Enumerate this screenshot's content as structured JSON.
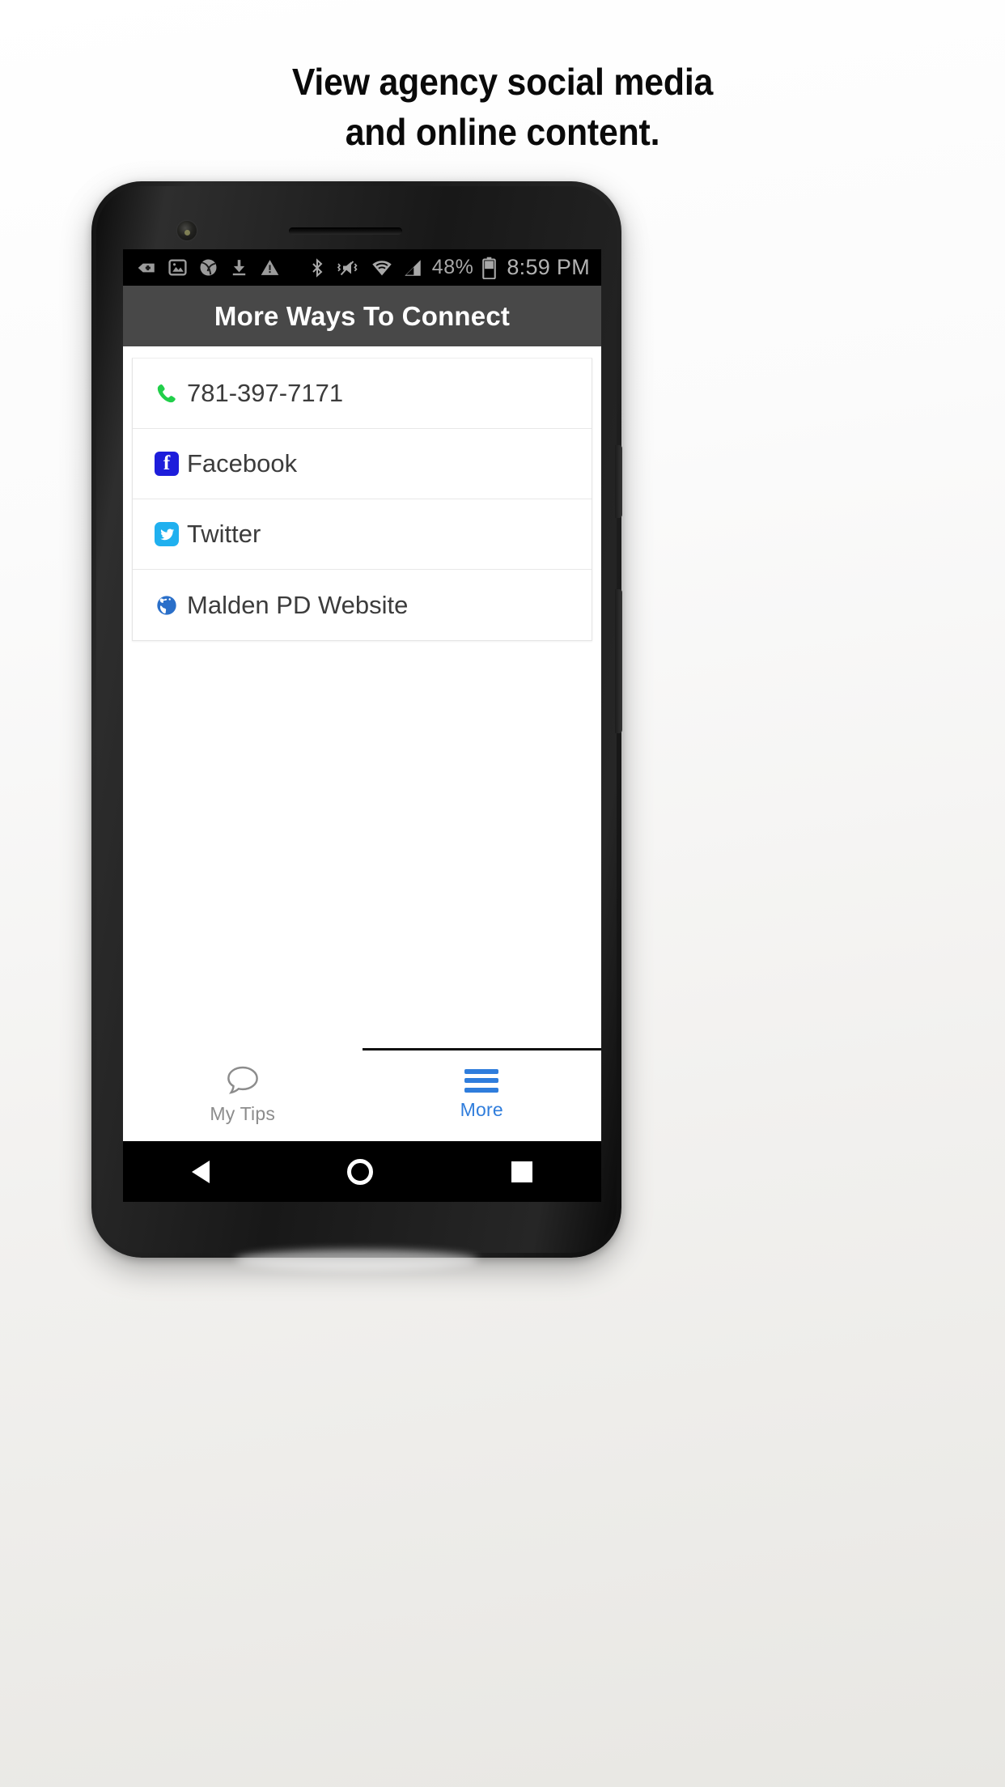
{
  "promo": {
    "headline_line1": "View agency social media",
    "headline_line2": "and online content."
  },
  "colors": {
    "statusbar_bg": "#000000",
    "titlebar_bg": "#484848",
    "accent_blue": "#2f7ddc",
    "facebook_blue": "#1d1ddb",
    "twitter_blue": "#20b0ef",
    "phone_green": "#21cf4a",
    "globe_blue": "#2a6fc9",
    "inactive_gray": "#8c8c8c",
    "row_text": "#3c3c3c"
  },
  "statusbar": {
    "left_icons": [
      "add-to-collection-icon",
      "image-icon",
      "sports-ball-icon",
      "download-icon",
      "warning-triangle-icon"
    ],
    "right_icons": [
      "bluetooth-icon",
      "vibrate-mute-icon",
      "wifi-icon",
      "cell-signal-icon"
    ],
    "battery_percent": "48%",
    "battery_icon": "battery-icon",
    "time": "8:59 PM"
  },
  "app": {
    "title": "More Ways To Connect",
    "list": [
      {
        "icon": "phone-handset-icon",
        "label": "781-397-7171"
      },
      {
        "icon": "facebook-icon",
        "label": "Facebook"
      },
      {
        "icon": "twitter-icon",
        "label": "Twitter"
      },
      {
        "icon": "globe-icon",
        "label": "Malden PD Website"
      }
    ],
    "tabs": [
      {
        "icon": "speech-bubble-icon",
        "label": "My Tips",
        "selected": false
      },
      {
        "icon": "hamburger-menu-icon",
        "label": "More",
        "selected": true
      }
    ]
  },
  "android_nav": {
    "back": "back-triangle-icon",
    "home": "home-circle-icon",
    "recents": "recents-square-icon"
  }
}
